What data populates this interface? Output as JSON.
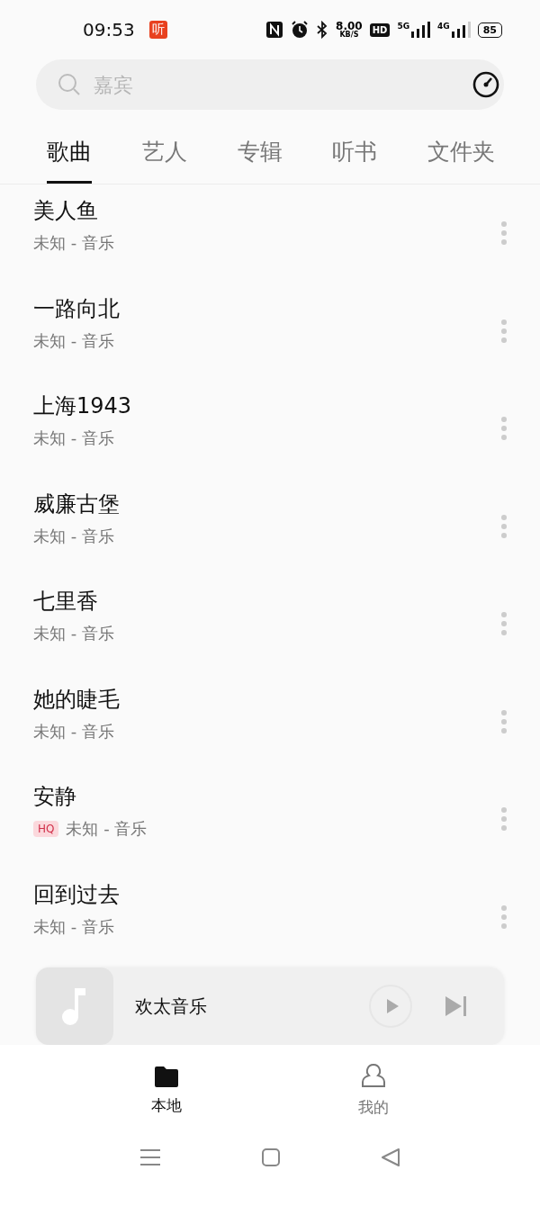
{
  "status_bar": {
    "time": "09:53",
    "app_badge": "听",
    "speed": "8.00",
    "speed_unit": "KB/S",
    "hd": "HD",
    "net1": "5G",
    "net2": "4G",
    "battery": "85"
  },
  "search": {
    "placeholder": "嘉宾"
  },
  "tabs": [
    {
      "label": "歌曲",
      "selected": true
    },
    {
      "label": "艺人",
      "selected": false
    },
    {
      "label": "专辑",
      "selected": false
    },
    {
      "label": "听书",
      "selected": false
    },
    {
      "label": "文件夹",
      "selected": false
    }
  ],
  "songs": [
    {
      "title": "美人鱼",
      "subtitle": "未知 - 音乐"
    },
    {
      "title": "一路向北",
      "subtitle": "未知 - 音乐"
    },
    {
      "title": "上海1943",
      "subtitle": "未知 - 音乐"
    },
    {
      "title": "威廉古堡",
      "subtitle": "未知 - 音乐"
    },
    {
      "title": "七里香",
      "subtitle": "未知 - 音乐"
    },
    {
      "title": "她的睫毛",
      "subtitle": "未知 - 音乐"
    },
    {
      "title": "安静",
      "subtitle": "未知 - 音乐",
      "tag": "HQ"
    },
    {
      "title": "回到过去",
      "subtitle": "未知 - 音乐"
    }
  ],
  "mini_player": {
    "title": "欢太音乐"
  },
  "bottom_nav": [
    {
      "label": "本地",
      "kind": "folder",
      "selected": true
    },
    {
      "label": "我的",
      "kind": "person",
      "selected": false
    }
  ]
}
